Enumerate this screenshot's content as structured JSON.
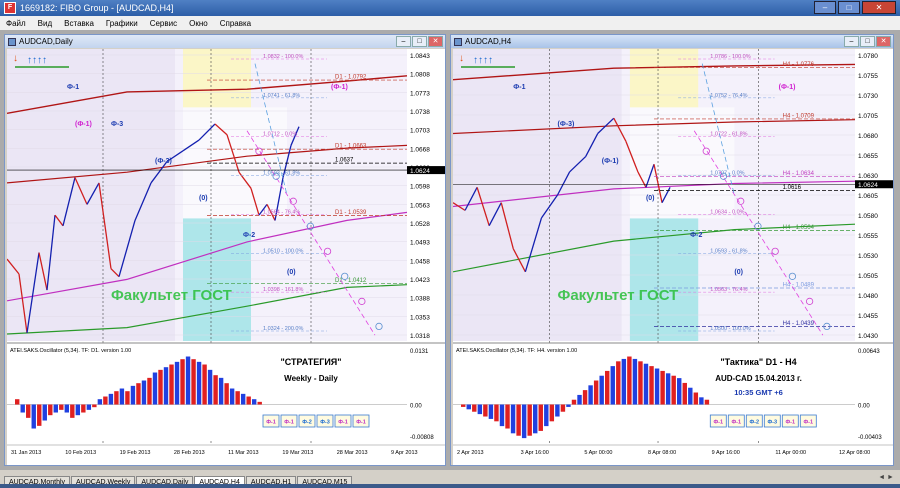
{
  "app": {
    "title": "1669182: FIBO Group - [AUDCAD,H4]",
    "icon_text": "F",
    "window_buttons": [
      "–",
      "□",
      "✕"
    ]
  },
  "menu": [
    "Файл",
    "Вид",
    "Вставка",
    "Графики",
    "Сервис",
    "Окно",
    "Справка"
  ],
  "tabs": [
    {
      "label": "AUDCAD,Monthly",
      "active": false
    },
    {
      "label": "AUDCAD,Weekly",
      "active": false
    },
    {
      "label": "AUDCAD,Daily",
      "active": false
    },
    {
      "label": "AUDCAD,H4",
      "active": true
    },
    {
      "label": "AUDCAD,H1",
      "active": false
    },
    {
      "label": "AUDCAD,M15",
      "active": false
    }
  ],
  "tab_scroll": "◄ ►",
  "chart_data": [
    {
      "type": "line",
      "window_title": "AUDCAD,Daily",
      "y_ticks": [
        "1.0843",
        "1.0808",
        "1.0773",
        "1.0738",
        "1.0703",
        "1.0668",
        "1.0633",
        "1.0598",
        "1.0563",
        "1.0528",
        "1.0493",
        "1.0458",
        "1.0423",
        "1.0388",
        "1.0353",
        "1.0318"
      ],
      "ylim": [
        1.0305,
        1.085
      ],
      "price_marker": "1.0624",
      "x_ticks": [
        "31 Jan 2013",
        "10 Feb 2013",
        "19 Feb 2013",
        "28 Feb 2013",
        "11 Mar 2013",
        "19 Mar 2013",
        "28 Mar 2013",
        "9 Apr 2013"
      ],
      "price_path": [
        [
          0,
          1.0458
        ],
        [
          0.03,
          1.043
        ],
        [
          0.05,
          1.032
        ],
        [
          0.08,
          1.047
        ],
        [
          0.1,
          1.04
        ],
        [
          0.12,
          1.054
        ],
        [
          0.14,
          1.052
        ],
        [
          0.17,
          1.061
        ],
        [
          0.2,
          1.056
        ],
        [
          0.23,
          1.06
        ],
        [
          0.26,
          1.044
        ],
        [
          0.28,
          1.0425
        ],
        [
          0.32,
          1.053
        ],
        [
          0.36,
          1.06
        ],
        [
          0.4,
          1.064
        ],
        [
          0.44,
          1.066
        ],
        [
          0.48,
          1.068
        ],
        [
          0.52,
          1.071
        ],
        [
          0.55,
          1.069
        ],
        [
          0.58,
          1.062
        ],
        [
          0.61,
          1.059
        ],
        [
          0.63,
          1.054
        ],
        [
          0.65,
          1.056
        ],
        [
          0.67,
          1.053
        ],
        [
          0.69,
          1.061
        ],
        [
          0.71,
          1.067
        ],
        [
          0.73,
          1.0705
        ]
      ],
      "envelope_upper": [
        [
          0,
          1.073
        ],
        [
          0.3,
          1.077
        ],
        [
          0.6,
          1.0775
        ],
        [
          0.85,
          1.079
        ],
        [
          1,
          1.08
        ]
      ],
      "envelope_mid": [
        [
          0,
          1.06
        ],
        [
          0.3,
          1.062
        ],
        [
          0.6,
          1.065
        ],
        [
          0.85,
          1.0665
        ],
        [
          1,
          1.067
        ]
      ],
      "envelope_lower_pink": [
        [
          0,
          1.038
        ],
        [
          0.3,
          1.042
        ],
        [
          0.6,
          1.049
        ],
        [
          0.85,
          1.053
        ],
        [
          1,
          1.0545
        ]
      ],
      "envelope_lower_green": [
        [
          0,
          1.0318
        ],
        [
          0.3,
          1.033
        ],
        [
          0.6,
          1.037
        ],
        [
          0.85,
          1.0405
        ],
        [
          1,
          1.041
        ]
      ],
      "labels": [
        {
          "text": "Ф-1",
          "kind": "wave"
        },
        {
          "text": "Ф-3",
          "kind": "wave"
        },
        {
          "text": "(Ф-3)",
          "kind": "wave"
        },
        {
          "text": "(0)",
          "kind": "wave"
        },
        {
          "text": "Ф-2",
          "kind": "wave"
        },
        {
          "text": "(0)",
          "kind": "wave"
        },
        {
          "text": "(Ф-1)",
          "kind": "target"
        },
        {
          "text": "(Ф-1)",
          "kind": "target"
        }
      ],
      "levels": [
        {
          "text": "D1 - 1.0792",
          "value": 1.0792,
          "color": "#c0392b"
        },
        {
          "text": "D1 - 1.0663",
          "value": 1.0663,
          "color": "#c0392b"
        },
        {
          "text": "D1 - 1.0539",
          "value": 1.0539,
          "color": "#c0392b"
        },
        {
          "text": "D1 - 1.0412",
          "value": 1.0412,
          "color": "#3a9a3a"
        },
        {
          "text": "1.0637",
          "value": 1.0637,
          "color": "#000000"
        }
      ],
      "fib_labels": [
        "1.0832 - 100.0%",
        "1.0741 - 61.8%",
        "1.0712 - 0.0%",
        "1.0593 - 61.8%",
        "1.0564 - 76.4%",
        "1.0510 - 100.0%",
        "1.0398 - 161.8%",
        "1.0324 - 200.0%"
      ],
      "watermark": "Факультет ГОСТ",
      "oscillator": {
        "label": "ATEI.SAKS.Oscillator (5,34). TF: D1. version 1.00",
        "y_ticks": [
          "0.0131",
          "0.00",
          "-0.00808"
        ],
        "values": [
          2,
          -3,
          -5,
          -9,
          -8,
          -6,
          -4,
          -3,
          -2,
          -3,
          -5,
          -4,
          -3,
          -2,
          -1,
          2,
          3,
          4,
          5,
          6,
          5,
          7,
          8,
          9,
          10,
          12,
          13,
          14,
          15,
          16,
          17,
          18,
          17,
          16,
          15,
          13,
          11,
          10,
          8,
          6,
          5,
          4,
          3,
          2,
          1
        ]
      },
      "note_title": "\"СТРАТЕГИЯ\"",
      "note_sub": "Weekly - Daily",
      "buttons": [
        "Ф-1",
        "Ф-1",
        "Ф-2",
        "Ф-3",
        "Ф-1",
        "Ф-1"
      ]
    },
    {
      "type": "line",
      "window_title": "AUDCAD,H4",
      "y_ticks": [
        "1.0780",
        "1.0755",
        "1.0730",
        "1.0705",
        "1.0680",
        "1.0655",
        "1.0630",
        "1.0605",
        "1.0580",
        "1.0555",
        "1.0530",
        "1.0505",
        "1.0480",
        "1.0455",
        "1.0430"
      ],
      "ylim": [
        1.042,
        1.08
      ],
      "price_marker": "1.0624",
      "x_ticks": [
        "2 Apr 2013",
        "3 Apr 16:00",
        "5 Apr 00:00",
        "8 Apr 08:00",
        "9 Apr 16:00",
        "11 Apr 00:00",
        "12 Apr 08:00"
      ],
      "price_path": [
        [
          0,
          1.06
        ],
        [
          0.03,
          1.059
        ],
        [
          0.06,
          1.062
        ],
        [
          0.09,
          1.057
        ],
        [
          0.12,
          1.06
        ],
        [
          0.15,
          1.054
        ],
        [
          0.18,
          1.051
        ],
        [
          0.22,
          1.058
        ],
        [
          0.26,
          1.061
        ],
        [
          0.29,
          1.064
        ],
        [
          0.33,
          1.066
        ],
        [
          0.36,
          1.069
        ],
        [
          0.4,
          1.071
        ],
        [
          0.43,
          1.068
        ],
        [
          0.46,
          1.064
        ],
        [
          0.48,
          1.062
        ],
        [
          0.5,
          1.065
        ],
        [
          0.52,
          1.06
        ],
        [
          0.54,
          1.062
        ]
      ],
      "envelope_upper": [
        [
          0,
          1.076
        ],
        [
          0.4,
          1.0775
        ],
        [
          0.7,
          1.0778
        ],
        [
          1,
          1.078
        ]
      ],
      "envelope_mid": [
        [
          0,
          1.069
        ],
        [
          0.4,
          1.07
        ],
        [
          0.7,
          1.0705
        ],
        [
          1,
          1.0708
        ]
      ],
      "envelope_lower_pink": [
        [
          0,
          1.0595
        ],
        [
          0.4,
          1.0618
        ],
        [
          0.7,
          1.0625
        ],
        [
          1,
          1.0628
        ]
      ],
      "envelope_lower_green": [
        [
          0,
          1.051
        ],
        [
          0.4,
          1.055
        ],
        [
          0.7,
          1.0565
        ],
        [
          1,
          1.0572
        ]
      ],
      "labels": [
        {
          "text": "Ф-1",
          "kind": "wave"
        },
        {
          "text": "(Ф-3)",
          "kind": "wave"
        },
        {
          "text": "(Ф-1)",
          "kind": "wave"
        },
        {
          "text": "(0)",
          "kind": "wave"
        },
        {
          "text": "Ф-2",
          "kind": "wave"
        },
        {
          "text": "(0)",
          "kind": "wave"
        },
        {
          "text": "(Ф-1)",
          "kind": "target"
        }
      ],
      "levels": [
        {
          "text": "H4 - 1.0776",
          "value": 1.0776,
          "color": "#c0392b"
        },
        {
          "text": "H4 - 1.0709",
          "value": 1.0709,
          "color": "#c0392b"
        },
        {
          "text": "H4 - 1.0634",
          "value": 1.0634,
          "color": "#c040c0"
        },
        {
          "text": "H4 - 1.0564",
          "value": 1.0564,
          "color": "#3a9a3a"
        },
        {
          "text": "H4 - 1.0489",
          "value": 1.0489,
          "color": "#7a9adf"
        },
        {
          "text": "H4 - 1.0439",
          "value": 1.0439,
          "color": "#3030a0"
        },
        {
          "text": "1.0616",
          "value": 1.0616,
          "color": "#000000"
        }
      ],
      "fib_labels": [
        "1.0786 - 100.0%",
        "1.0752 - 76.4%",
        "1.0722 - 61.8%",
        "1.0707 - 0.0%",
        "1.0634 - 0.0%",
        "1.0593 - 61.8%",
        "1.0563 - 76.4%",
        "1.0500 - 100.0%"
      ],
      "watermark": "Факультет ГОСТ",
      "oscillator": {
        "label": "ATEI.SAKS.Oscillator (5,34). TF: H4. version 1.00",
        "y_ticks": [
          "0.00643",
          "0.00",
          "-0.00403"
        ],
        "values": [
          -1,
          -2,
          -3,
          -4,
          -5,
          -6,
          -7,
          -9,
          -10,
          -12,
          -13,
          -14,
          -13,
          -12,
          -11,
          -9,
          -7,
          -5,
          -3,
          -1,
          2,
          4,
          6,
          8,
          10,
          12,
          14,
          16,
          18,
          19,
          20,
          19,
          18,
          17,
          16,
          15,
          14,
          13,
          12,
          11,
          9,
          7,
          5,
          3,
          2
        ]
      },
      "note_title": "\"Тактика\"  D1 - H4",
      "note_sub": "AUD-CAD    15.04.2013  г.",
      "note_time": "10:35   GMT +6",
      "buttons": [
        "Ф-1",
        "Ф-1",
        "Ф-2",
        "Ф-3",
        "Ф-1",
        "Ф-1"
      ]
    }
  ]
}
